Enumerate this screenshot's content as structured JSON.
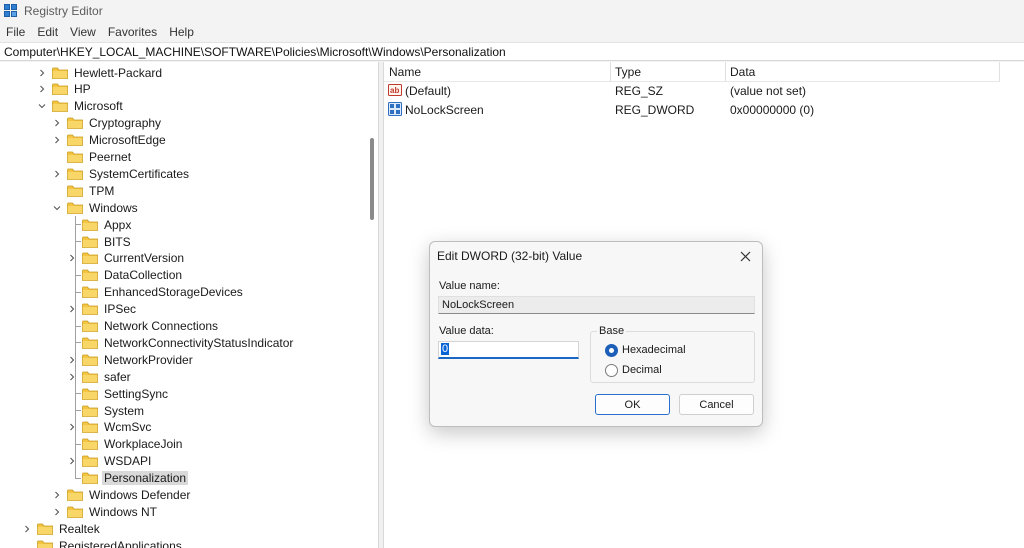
{
  "window": {
    "title": "Registry Editor"
  },
  "menu": [
    "File",
    "Edit",
    "View",
    "Favorites",
    "Help"
  ],
  "address": "Computer\\HKEY_LOCAL_MACHINE\\SOFTWARE\\Policies\\Microsoft\\Windows\\Personalization",
  "tree": {
    "items": [
      {
        "label": "Hewlett-Packard",
        "chevron": "right"
      },
      {
        "label": "HP",
        "chevron": "right"
      },
      {
        "label": "Microsoft",
        "chevron": "down"
      },
      {
        "label": "Cryptography",
        "chevron": "right"
      },
      {
        "label": "MicrosoftEdge",
        "chevron": "right"
      },
      {
        "label": "Peernet",
        "chevron": "none"
      },
      {
        "label": "SystemCertificates",
        "chevron": "right"
      },
      {
        "label": "TPM",
        "chevron": "none"
      },
      {
        "label": "Windows",
        "chevron": "down"
      },
      {
        "label": "Appx",
        "chevron": "none"
      },
      {
        "label": "BITS",
        "chevron": "none"
      },
      {
        "label": "CurrentVersion",
        "chevron": "right"
      },
      {
        "label": "DataCollection",
        "chevron": "none"
      },
      {
        "label": "EnhancedStorageDevices",
        "chevron": "none"
      },
      {
        "label": "IPSec",
        "chevron": "right"
      },
      {
        "label": "Network Connections",
        "chevron": "none"
      },
      {
        "label": "NetworkConnectivityStatusIndicator",
        "chevron": "none"
      },
      {
        "label": "NetworkProvider",
        "chevron": "right"
      },
      {
        "label": "safer",
        "chevron": "right"
      },
      {
        "label": "SettingSync",
        "chevron": "none"
      },
      {
        "label": "System",
        "chevron": "none"
      },
      {
        "label": "WcmSvc",
        "chevron": "right"
      },
      {
        "label": "WorkplaceJoin",
        "chevron": "none"
      },
      {
        "label": "WSDAPI",
        "chevron": "right"
      },
      {
        "label": "Personalization",
        "chevron": "none",
        "selected": true
      },
      {
        "label": "Windows Defender",
        "chevron": "right"
      },
      {
        "label": "Windows NT",
        "chevron": "right"
      },
      {
        "label": "Realtek",
        "chevron": "right"
      },
      {
        "label": "RegisteredApplications",
        "chevron": "none"
      }
    ]
  },
  "list": {
    "columns": [
      "Name",
      "Type",
      "Data"
    ],
    "rows": [
      {
        "name": "(Default)",
        "type": "REG_SZ",
        "data": "(value not set)",
        "icon": "string-value-icon"
      },
      {
        "name": "NoLockScreen",
        "type": "REG_DWORD",
        "data": "0x00000000 (0)",
        "icon": "binary-value-icon"
      }
    ]
  },
  "dialog": {
    "title": "Edit DWORD (32-bit) Value",
    "value_name_label": "Value name:",
    "value_name": "NoLockScreen",
    "value_data_label": "Value data:",
    "value_data": "0",
    "base_label": "Base",
    "base_options": [
      "Hexadecimal",
      "Decimal"
    ],
    "base_selected": "Hexadecimal",
    "ok_label": "OK",
    "cancel_label": "Cancel"
  }
}
